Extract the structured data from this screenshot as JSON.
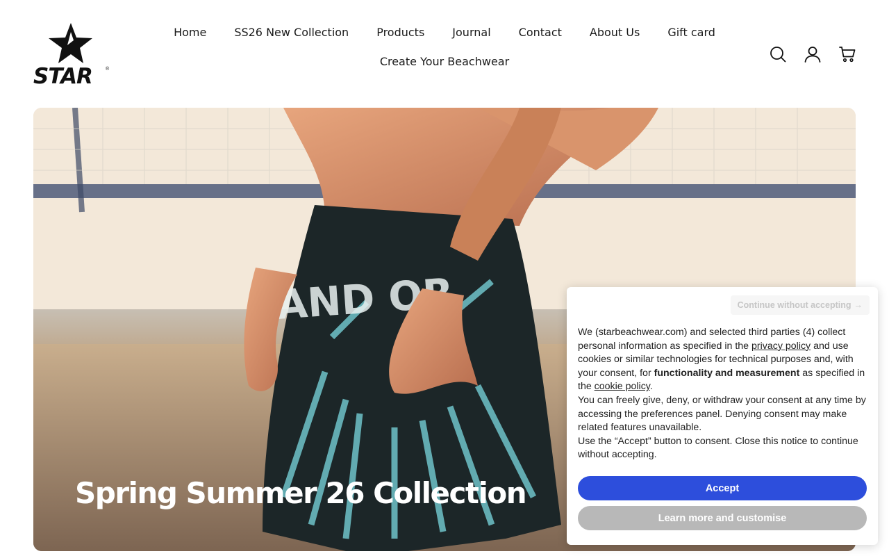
{
  "brand": {
    "logo_text": "STAR",
    "logo_mark": "®"
  },
  "nav": {
    "items": [
      {
        "label": "Home"
      },
      {
        "label": "SS26 New Collection"
      },
      {
        "label": "Products"
      },
      {
        "label": "Journal"
      },
      {
        "label": "Contact"
      },
      {
        "label": "About Us"
      },
      {
        "label": "Gift card"
      },
      {
        "label": "Create Your Beachwear"
      }
    ]
  },
  "header_icons": [
    "search-icon",
    "account-icon",
    "cart-icon"
  ],
  "hero": {
    "title": "Spring Summer 26 Collection",
    "shorts_print_text": "AND OR"
  },
  "cookie_banner": {
    "continue_label": "Continue without accepting",
    "continue_arrow": "→",
    "p1_a": "We (starbeachwear.com) and selected third parties (4) collect personal information as specified in the ",
    "privacy_link": "privacy policy",
    "p1_b": " and use cookies or similar technologies for technical purposes and, with your consent, for ",
    "p1_bold": "functionality and measurement",
    "p1_c": " as specified in the ",
    "cookie_link": "cookie policy",
    "p1_d": ".",
    "p2": "You can freely give, deny, or withdraw your consent at any time by accessing the preferences panel. Denying consent may make related features unavailable.",
    "p3": "Use the “Accept” button to consent. Close this notice to continue without accepting.",
    "accept_label": "Accept",
    "learn_label": "Learn more and customise"
  },
  "colors": {
    "accept_bg": "#2d4edc",
    "learn_bg": "#b8b8b8",
    "text": "#111111"
  }
}
